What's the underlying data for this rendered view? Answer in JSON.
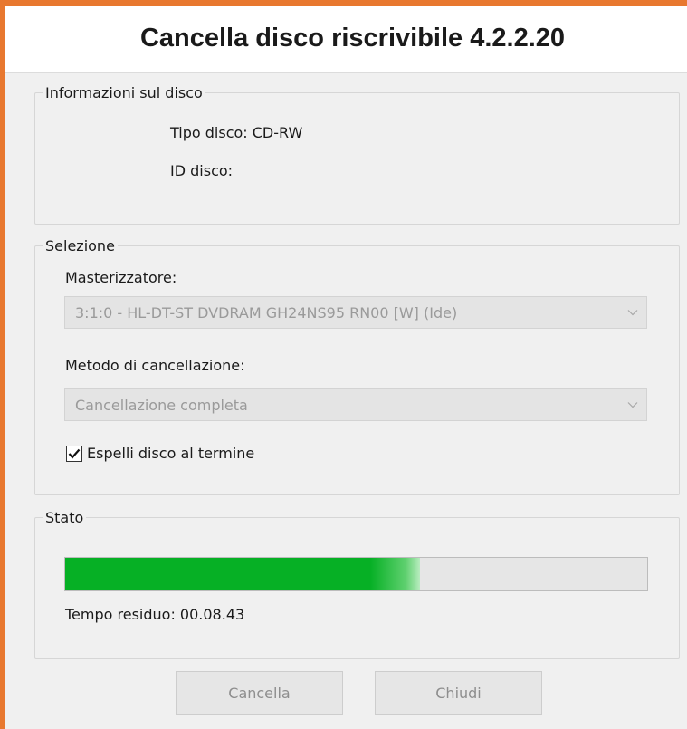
{
  "window": {
    "title": "Cancella disco riscrivibile 4.2.2.20"
  },
  "disc_info": {
    "legend": "Informazioni sul disco",
    "type_label": "Tipo disco: CD-RW",
    "id_label": "ID disco:"
  },
  "selection": {
    "legend": "Selezione",
    "burner_label": "Masterizzatore:",
    "burner_value": "3:1:0 - HL-DT-ST DVDRAM GH24NS95 RN00 [W] (Ide)",
    "method_label": "Metodo di cancellazione:",
    "method_value": "Cancellazione completa",
    "eject_label": "Espelli disco al termine",
    "eject_checked": true
  },
  "status": {
    "legend": "Stato",
    "progress_percent": 61,
    "time_remaining": "Tempo residuo: 00.08.43"
  },
  "buttons": {
    "cancel_label": "Cancella",
    "close_label": "Chiudi"
  },
  "colors": {
    "window_border": "#e8782f",
    "progress_fill": "#06b025"
  }
}
